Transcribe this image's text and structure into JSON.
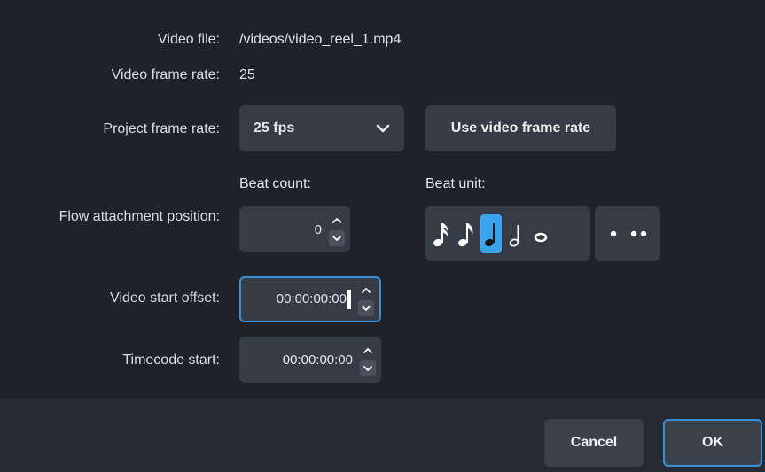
{
  "fields": {
    "video_file_label": "Video file:",
    "video_file_value": "/videos/video_reel_1.mp4",
    "video_frame_rate_label": "Video frame rate:",
    "video_frame_rate_value": "25",
    "project_frame_rate_label": "Project frame rate:",
    "project_frame_rate_value": "25 fps",
    "use_video_frame_rate_label": "Use video frame rate",
    "beat_count_label": "Beat count:",
    "beat_unit_label": "Beat unit:",
    "flow_attachment_label": "Flow attachment position:",
    "beat_count_value": "0",
    "video_start_offset_label": "Video start offset:",
    "video_start_offset_value": "00:00:00:00",
    "timecode_start_label": "Timecode start:",
    "timecode_start_value": "00:00:00:00"
  },
  "beat_units": {
    "selected": "quarter-note",
    "options": [
      "sixteenth-note",
      "eighth-note",
      "quarter-note",
      "half-note",
      "whole-note"
    ],
    "dots": [
      "single-dot",
      "double-dot"
    ]
  },
  "footer": {
    "cancel_label": "Cancel",
    "ok_label": "OK"
  },
  "colors": {
    "background": "#1f2329",
    "control": "#363c45",
    "accent": "#3ba4ee",
    "focus_border": "#3b8fd6"
  }
}
